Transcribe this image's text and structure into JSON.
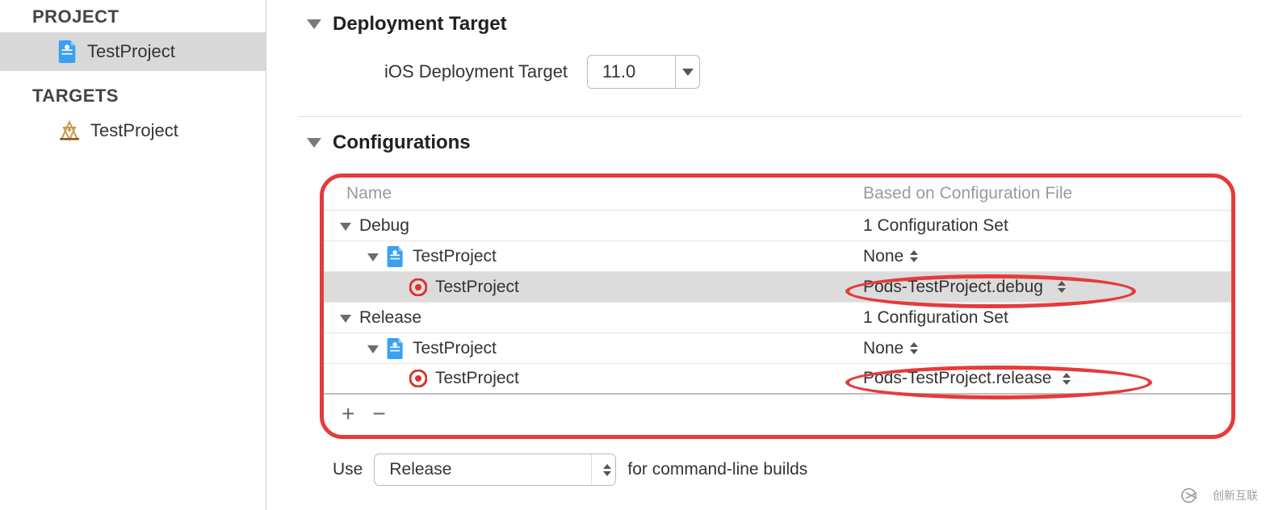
{
  "sidebar": {
    "projectHeader": "PROJECT",
    "projectName": "TestProject",
    "targetsHeader": "TARGETS",
    "targetName": "TestProject"
  },
  "deployment": {
    "sectionTitle": "Deployment Target",
    "label": "iOS Deployment Target",
    "value": "11.0"
  },
  "configurations": {
    "sectionTitle": "Configurations",
    "colName": "Name",
    "colBased": "Based on Configuration File",
    "items": [
      {
        "name": "Debug",
        "value": "1 Configuration Set"
      },
      {
        "name": "TestProject",
        "value": "None"
      },
      {
        "name": "TestProject",
        "value": "Pods-TestProject.debug"
      },
      {
        "name": "Release",
        "value": "1 Configuration Set"
      },
      {
        "name": "TestProject",
        "value": "None"
      },
      {
        "name": "TestProject",
        "value": "Pods-TestProject.release"
      }
    ],
    "add": "+",
    "remove": "−"
  },
  "useRow": {
    "prefix": "Use",
    "selected": "Release",
    "suffix": "for command-line builds"
  },
  "watermark": "创新互联"
}
